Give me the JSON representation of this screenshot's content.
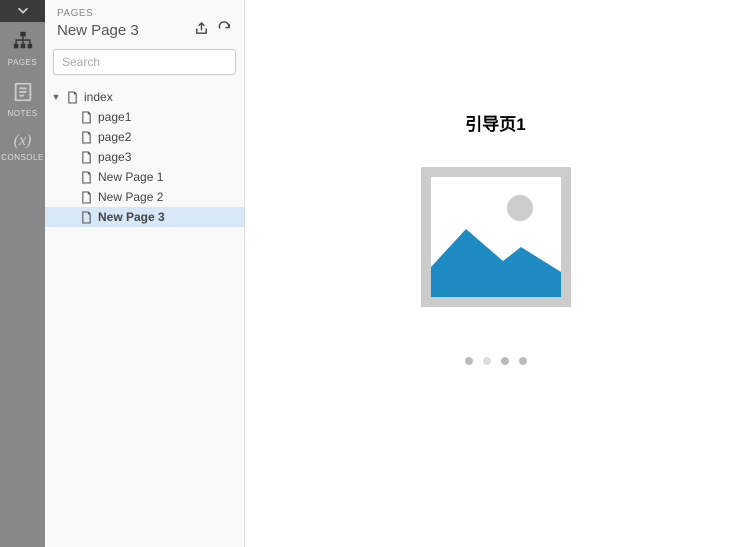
{
  "rail": {
    "items": [
      {
        "id": "pages",
        "label": "PAGES"
      },
      {
        "id": "notes",
        "label": "NOTES"
      },
      {
        "id": "console",
        "label": "CONSOLE"
      }
    ]
  },
  "panel": {
    "section_label": "PAGES",
    "title": "New Page 3",
    "search_placeholder": "Search"
  },
  "tree": {
    "root": {
      "label": "index",
      "children": [
        {
          "label": "page1",
          "selected": false
        },
        {
          "label": "page2",
          "selected": false
        },
        {
          "label": "page3",
          "selected": false
        },
        {
          "label": "New Page 1",
          "selected": false
        },
        {
          "label": "New Page 2",
          "selected": false
        },
        {
          "label": "New Page 3",
          "selected": true
        }
      ]
    }
  },
  "canvas": {
    "heading": "引导页1",
    "carousel": {
      "total": 4,
      "active_index": 1
    }
  }
}
